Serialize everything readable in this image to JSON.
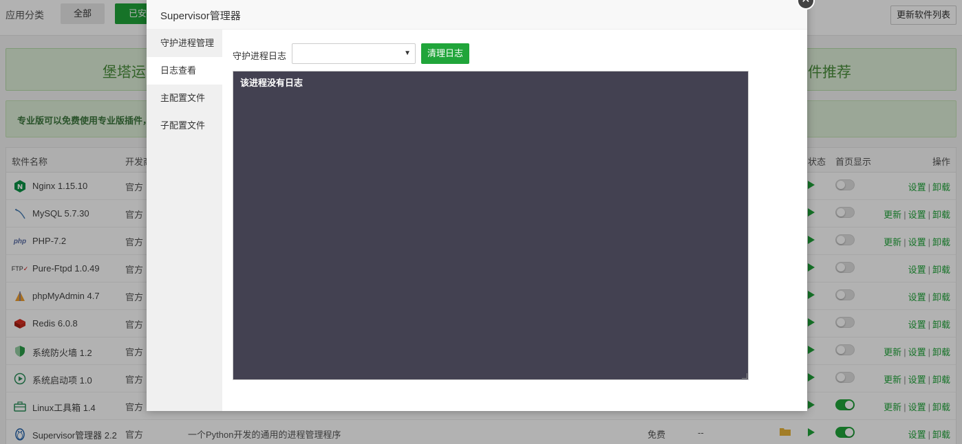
{
  "background": {
    "category_label": "应用分类",
    "category_all": "全部",
    "category_installed": "已安",
    "refresh_button": "更新软件列表",
    "rec_banner_left": "堡塔运",
    "rec_banner_right": "件推荐",
    "pro_banner": "专业版可以免费使用专业版插件，",
    "table_headers": {
      "name": "软件名称",
      "developer": "开发商",
      "status": "状态",
      "homepage": "首页显示",
      "operation": "操作"
    },
    "rows": [
      {
        "name": "Nginx 1.15.10",
        "dev": "官方",
        "icon": "nginx-icon",
        "ops": [
          "设置",
          "卸载"
        ],
        "toggle": false
      },
      {
        "name": "MySQL 5.7.30",
        "dev": "官方",
        "icon": "mysql-icon",
        "ops": [
          "更新",
          "设置",
          "卸载"
        ],
        "toggle": false
      },
      {
        "name": "PHP-7.2",
        "dev": "官方",
        "icon": "php-icon",
        "ops": [
          "更新",
          "设置",
          "卸载"
        ],
        "toggle": false
      },
      {
        "name": "Pure-Ftpd 1.0.49",
        "dev": "官方",
        "icon": "ftp-icon",
        "ops": [
          "设置",
          "卸载"
        ],
        "toggle": false
      },
      {
        "name": "phpMyAdmin 4.7",
        "dev": "官方",
        "icon": "phpmyadmin-icon",
        "ops": [
          "设置",
          "卸载"
        ],
        "toggle": false
      },
      {
        "name": "Redis 6.0.8",
        "dev": "官方",
        "icon": "redis-icon",
        "ops": [
          "设置",
          "卸载"
        ],
        "toggle": false
      },
      {
        "name": "系统防火墙 1.2",
        "dev": "官方",
        "icon": "shield-icon",
        "ops": [
          "更新",
          "设置",
          "卸载"
        ],
        "toggle": false
      },
      {
        "name": "系统启动项 1.0",
        "dev": "官方",
        "icon": "startup-icon",
        "ops": [
          "更新",
          "设置",
          "卸载"
        ],
        "toggle": false
      },
      {
        "name": "Linux工具箱 1.4",
        "dev": "官方",
        "icon": "toolbox-icon",
        "ops": [
          "更新",
          "设置",
          "卸载"
        ],
        "toggle": true
      },
      {
        "name": "Supervisor管理器 2.2",
        "dev": "官方",
        "icon": "penguin-icon",
        "desc": "一个Python开发的通用的进程管理程序",
        "price": "免费",
        "expire": "--",
        "ops": [
          "设置",
          "卸载"
        ],
        "toggle": true
      }
    ]
  },
  "modal": {
    "title": "Supervisor管理器",
    "close_icon": "close-icon",
    "sidebar": [
      {
        "label": "守护进程管理",
        "active": false
      },
      {
        "label": "日志查看",
        "active": true
      },
      {
        "label": "主配置文件",
        "active": false
      },
      {
        "label": "子配置文件",
        "active": false
      }
    ],
    "log_label": "守护进程日志",
    "log_select_value": "",
    "clear_button": "清理日志",
    "log_content": "该进程没有日志"
  },
  "colors": {
    "accent": "#20a53a",
    "log_bg": "#434151"
  }
}
